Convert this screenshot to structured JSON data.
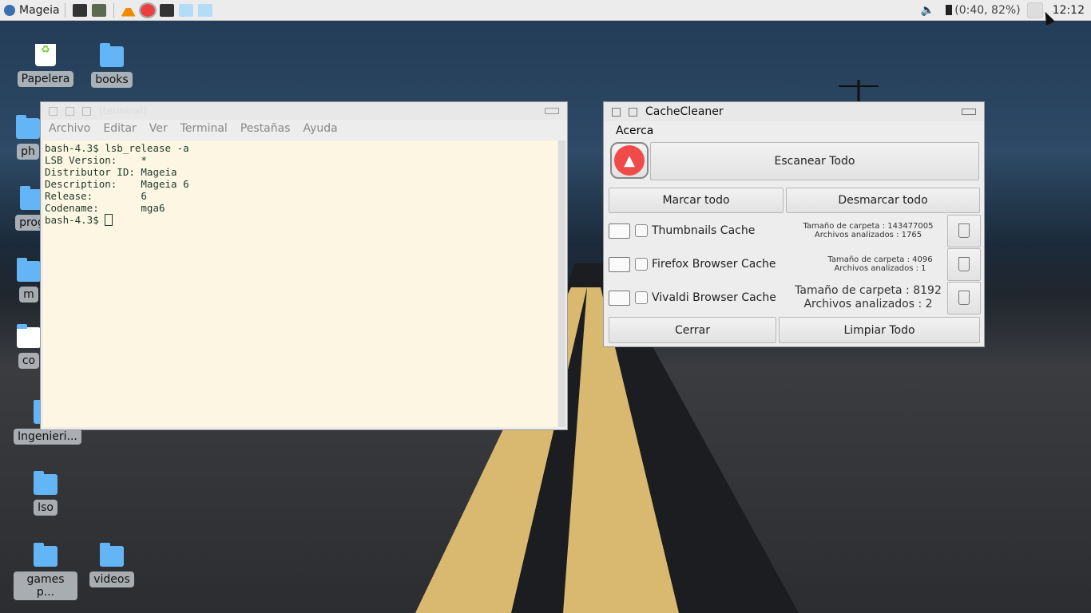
{
  "panel": {
    "menu_label": "Mageia",
    "battery": "(0:40, 82%)",
    "clock": "12:12",
    "launchers": [
      "terminal-icon",
      "file-manager-icon",
      "vlc-icon",
      "cachecleaner-icon",
      "terminal-icon",
      "folder-icon",
      "folder-icon"
    ]
  },
  "desktop": {
    "icons": [
      {
        "label": "Papelera"
      },
      {
        "label": "books"
      },
      {
        "label": "ph"
      },
      {
        "label": "prog"
      },
      {
        "label": "m"
      },
      {
        "label": "co"
      },
      {
        "label": "Ingenieri..."
      },
      {
        "label": "Iso"
      },
      {
        "label": "games p..."
      },
      {
        "label": "videos"
      }
    ]
  },
  "terminal": {
    "title": "[terminal]",
    "menu": [
      "Archivo",
      "Editar",
      "Ver",
      "Terminal",
      "Pestañas",
      "Ayuda"
    ],
    "lines": [
      "bash-4.3$ lsb_release -a",
      "LSB Version:    *",
      "Distributor ID: Mageia",
      "Description:    Mageia 6",
      "Release:        6",
      "Codename:       mga6"
    ],
    "prompt": "bash-4.3$ "
  },
  "cachecleaner": {
    "title": "CacheCleaner",
    "menu": "Acerca",
    "scan": "Escanear Todo",
    "mark_all": "Marcar todo",
    "unmark_all": "Desmarcar todo",
    "rows": [
      {
        "name": "Thumbnails Cache",
        "size": "Tamaño de carpeta : 143477005",
        "files": "Archivos analizados : 1765",
        "checked": false
      },
      {
        "name": "Firefox Browser Cache",
        "size": "Tamaño de carpeta : 4096",
        "files": "Archivos analizados : 1",
        "checked": false
      },
      {
        "name": "Vivaldi Browser Cache",
        "size": "Tamaño de carpeta : 8192",
        "files": "Archivos analizados : 2",
        "checked": false
      }
    ],
    "close": "Cerrar",
    "clean_all": "Limpiar Todo",
    "accent": "#ef4b4b"
  }
}
